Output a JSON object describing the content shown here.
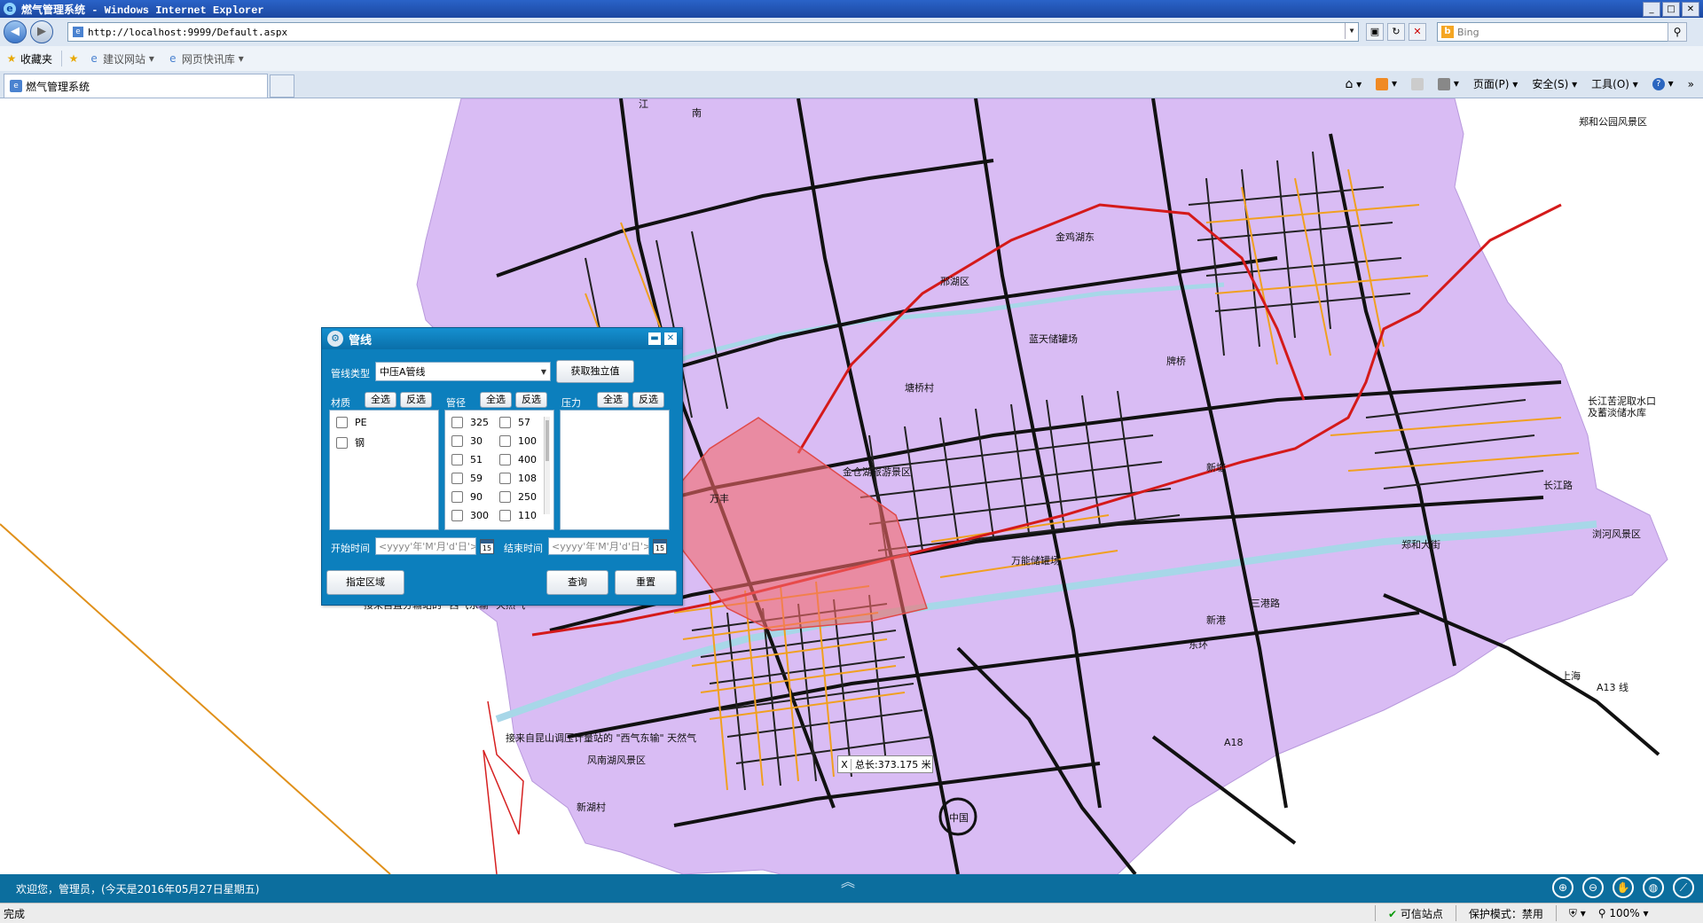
{
  "window": {
    "title": "燃气管理系统 - Windows Internet Explorer",
    "buttons": [
      "_",
      "□",
      "✕"
    ]
  },
  "address": {
    "url": "http://localhost:9999/Default.aspx",
    "search_placeholder": "Bing"
  },
  "favorites": {
    "label": "收藏夹",
    "items": [
      "建议网站",
      "网页快讯库"
    ]
  },
  "tab": {
    "title": "燃气管理系统"
  },
  "command_bar": {
    "home": "⌂",
    "page": "页面(P)",
    "safety": "安全(S)",
    "tools": "工具(O)",
    "help": "?"
  },
  "panel": {
    "title": "管线",
    "pipe_type_label": "管线类型",
    "pipe_type_value": "中压A管线",
    "get_unique_button": "获取独立值",
    "material": {
      "label": "材质",
      "select_all": "全选",
      "invert": "反选",
      "items": [
        "PE",
        "钢"
      ]
    },
    "diameter": {
      "label": "管径",
      "select_all": "全选",
      "invert": "反选",
      "col1": [
        "325",
        "30",
        "51",
        "59",
        "90",
        "300"
      ],
      "col2": [
        "57",
        "100",
        "400",
        "108",
        "250",
        "110"
      ]
    },
    "pressure": {
      "label": "压力",
      "select_all": "全选",
      "invert": "反选"
    },
    "start_time_label": "开始时间",
    "end_time_label": "结束时间",
    "date_placeholder": "<yyyy'年'M'月'd'日'>",
    "calendar_num": "15",
    "region_button": "指定区域",
    "query_button": "查询",
    "reset_button": "重置"
  },
  "measure": {
    "close": "X",
    "text": "总长:373.175 米"
  },
  "map": {
    "colors": {
      "land": "#d9bcf4",
      "water": "#a7d7e8",
      "road": "#111111",
      "minor": "#f0a020",
      "rail": "#d41a1a",
      "area": "#f46a6a"
    },
    "labels": [
      {
        "t": "江",
        "cls": "road"
      },
      {
        "t": "南",
        "cls": "road"
      },
      {
        "t": "郑和公园风景区",
        "cls": "poi"
      },
      {
        "t": "金鸡湖东",
        "cls": "poi"
      },
      {
        "t": "邢湖区",
        "cls": "poi"
      },
      {
        "t": "塘桥村",
        "cls": "poi"
      },
      {
        "t": "蓝天储罐场",
        "cls": "poi"
      },
      {
        "t": "牌桥",
        "cls": "poi"
      },
      {
        "t": "中国",
        "cls": "poi"
      },
      {
        "t": "万丰",
        "cls": "poi"
      },
      {
        "t": "新塘",
        "cls": "poi"
      },
      {
        "t": "长江苦泥取水口",
        "cls": "poi"
      },
      {
        "t": "及蓄淡储水库",
        "cls": "poi"
      },
      {
        "t": "浏河风景区",
        "cls": "poi"
      },
      {
        "t": "郑和大街",
        "cls": "poi"
      },
      {
        "t": "三港路",
        "cls": "poi"
      },
      {
        "t": "东环",
        "cls": "poi"
      },
      {
        "t": "新港",
        "cls": "poi"
      },
      {
        "t": "风南湖风景区",
        "cls": "poi"
      },
      {
        "t": "新湖村",
        "cls": "poi"
      },
      {
        "t": "接来自直分输站的 \"西气东输\" 天然气",
        "cls": "note"
      },
      {
        "t": "接来自昆山调压计量站的 \"西气东输\" 天然气",
        "cls": "note"
      },
      {
        "t": "A18",
        "cls": "road"
      },
      {
        "t": "A13 线",
        "cls": "road"
      },
      {
        "t": "上海",
        "cls": "road"
      },
      {
        "t": "长江路",
        "cls": "poi"
      },
      {
        "t": "金仓湖旅游景区",
        "cls": "poi"
      },
      {
        "t": "万能储罐场",
        "cls": "poi"
      }
    ]
  },
  "status": {
    "welcome": "欢迎您，管理员，(今天是2016年05月27日星期五)",
    "chevron": "︽"
  },
  "ie_status": {
    "done": "完成",
    "zone": "可信站点",
    "protect": "保护模式：禁用",
    "zoom": "100%"
  }
}
